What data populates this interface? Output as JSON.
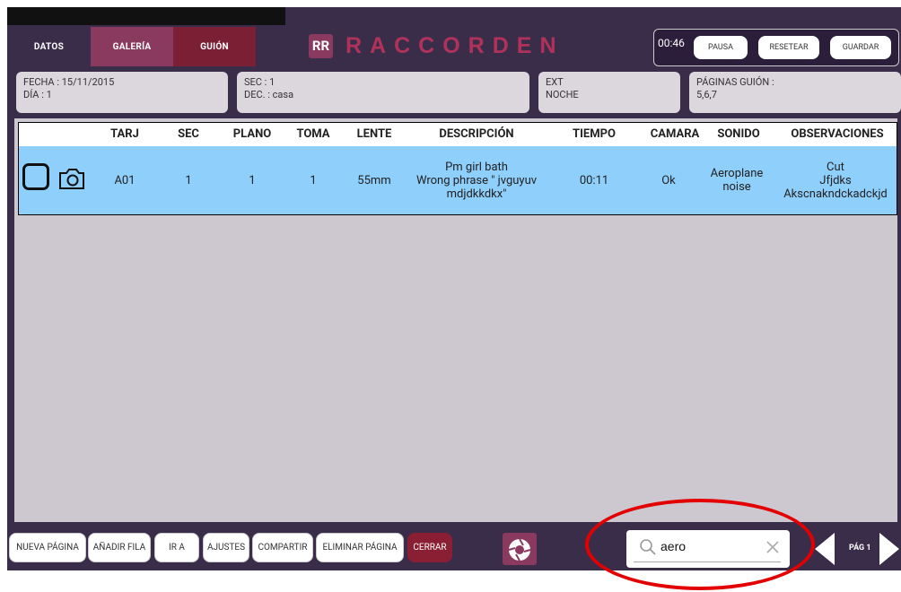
{
  "tabs": [
    "DATOS",
    "GALERÍA",
    "GUIÓN"
  ],
  "logo": {
    "mark": "RR",
    "word": "RACCORDEN"
  },
  "timer": {
    "time": "00:46",
    "pause": "PAUSA",
    "reset": "RESETEAR",
    "save": "GUARDAR"
  },
  "info": {
    "fecha": "FECHA : 15/11/2015",
    "dia": "DÍA : 1",
    "sec": "SEC : 1",
    "dec": "DEC. : casa",
    "ext": "EXT",
    "noche": "NOCHE",
    "paginas_label": "PÁGINAS GUIÓN :",
    "paginas_value": "5,6,7"
  },
  "table": {
    "headers": [
      "TARJ",
      "SEC",
      "PLANO",
      "TOMA",
      "LENTE",
      "DESCRIPCIÓN",
      "TIEMPO",
      "CAMARA",
      "SONIDO",
      "OBSERVACIONES"
    ],
    "row": {
      "tarj": "A01",
      "sec": "1",
      "plano": "1",
      "toma": "1",
      "lente": "55mm",
      "descripcion": [
        "Pm girl bath",
        "Wrong phrase \" jvguyuv",
        "mdjdkkdkx\""
      ],
      "tiempo": "00:11",
      "camara": "Ok",
      "sonido": [
        "Aeroplane",
        "noise"
      ],
      "observaciones": [
        "Cut",
        "Jfjdks",
        "Akscnakndckadckjd"
      ]
    }
  },
  "bottom": {
    "nueva_pagina": "NUEVA PÁGINA",
    "anadir_fila": "AÑADIR FILA",
    "ir_a": "IR A",
    "ajustes": "AJUSTES",
    "compartir": "COMPARTIR",
    "eliminar_pagina": "ELIMINAR PÁGINA",
    "cerrar": "CERRAR",
    "page": "PÁG  1"
  },
  "search": {
    "value": "aero"
  },
  "colors": {
    "accent": "#8a3a5e",
    "bg": "#3a2d4a",
    "row_highlight": "#8fcffb",
    "annotation": "#e30000"
  }
}
